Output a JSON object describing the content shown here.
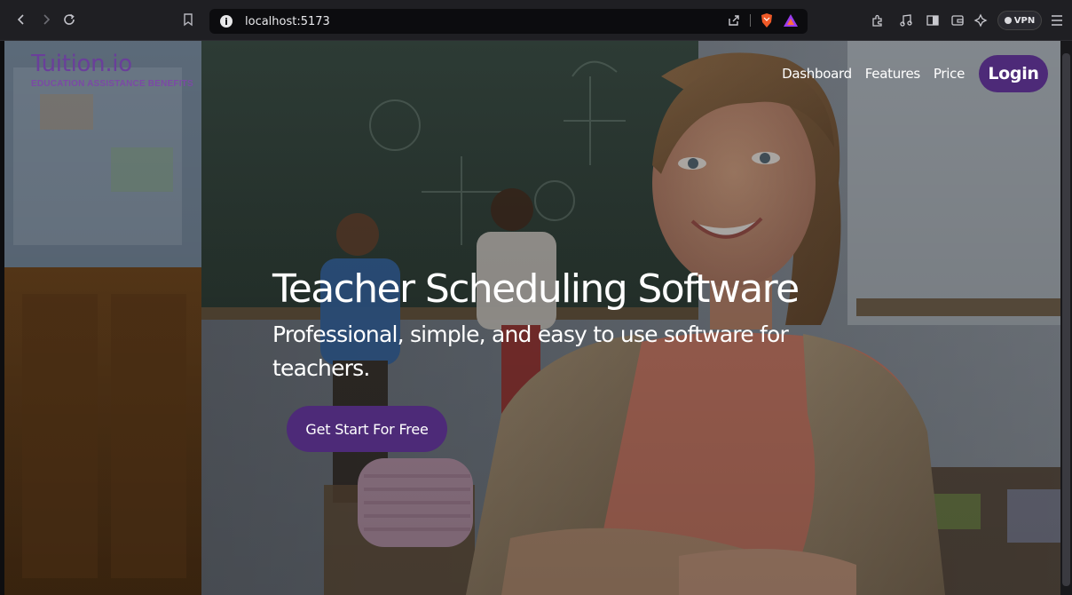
{
  "browser": {
    "url": "localhost:5173",
    "vpn_label": "VPN"
  },
  "site": {
    "logo_name": "Tuition.io",
    "logo_tagline": "EDUCATION ASSISTANCE BENEFITS",
    "nav": {
      "dashboard": "Dashboard",
      "features": "Features",
      "price": "Price",
      "login": "Login"
    },
    "hero": {
      "headline": "Teacher Scheduling Software",
      "subline": "Professional, simple, and easy to use software for teachers.",
      "cta": "Get Start For Free"
    }
  },
  "colors": {
    "brand_purple": "#4d2a78",
    "logo_purple": "#6a3f9a",
    "chrome_bg": "#1f1f23"
  },
  "icons": [
    "back-icon",
    "forward-icon",
    "reload-icon",
    "bookmark-icon",
    "site-info-icon",
    "share-icon",
    "brave-shields-icon",
    "brave-rewards-icon",
    "extensions-icon",
    "media-icon",
    "sidebar-icon",
    "wallet-icon",
    "leo-ai-icon",
    "menu-icon"
  ]
}
